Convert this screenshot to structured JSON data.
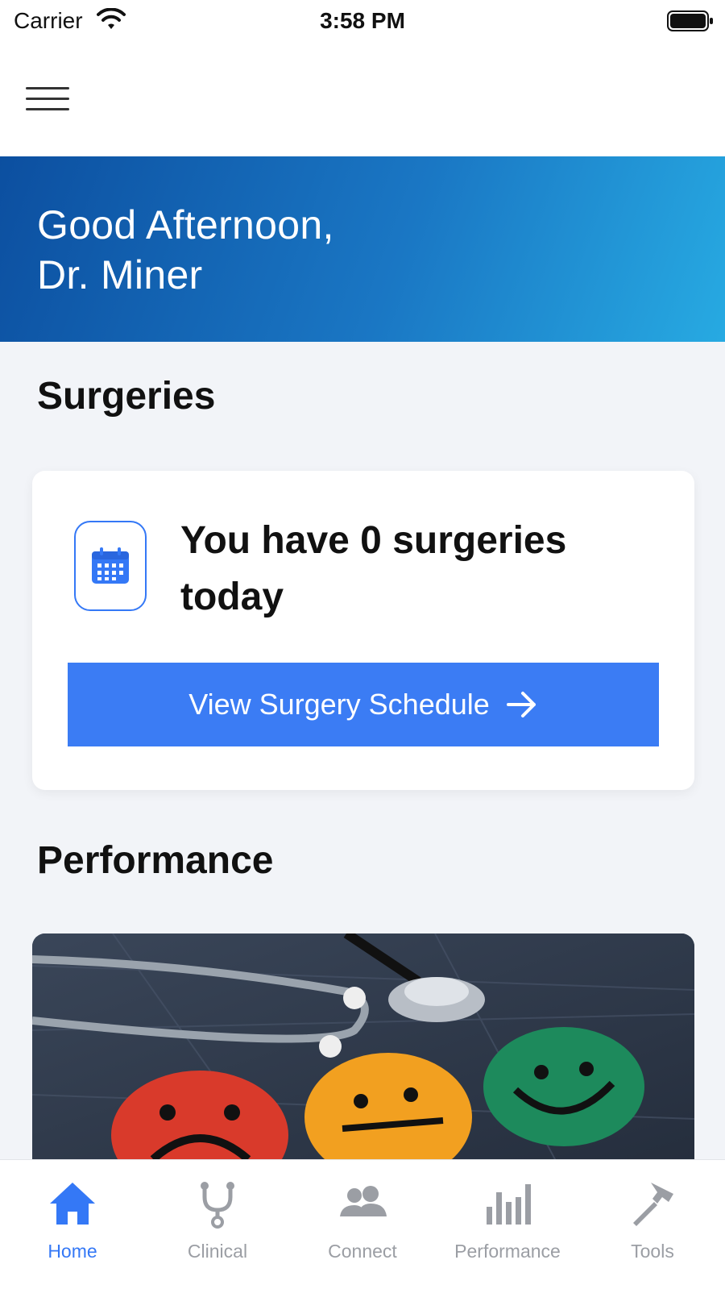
{
  "status_bar": {
    "carrier": "Carrier",
    "time": "3:58 PM"
  },
  "greeting": {
    "line1": "Good Afternoon,",
    "line2": "Dr. Miner"
  },
  "surgeries": {
    "section_title": "Surgeries",
    "count_text": "You have 0 surgeries today",
    "button_label": "View Surgery Schedule",
    "icon": "calendar-icon"
  },
  "performance": {
    "section_title": "Performance",
    "image": "stethoscope-with-sad-neutral-happy-faces"
  },
  "tabs": [
    {
      "label": "Home",
      "icon": "home-icon",
      "active": true
    },
    {
      "label": "Clinical",
      "icon": "stethoscope-icon",
      "active": false
    },
    {
      "label": "Connect",
      "icon": "people-icon",
      "active": false
    },
    {
      "label": "Performance",
      "icon": "bar-chart-icon",
      "active": false
    },
    {
      "label": "Tools",
      "icon": "hammer-icon",
      "active": false
    }
  ],
  "colors": {
    "accent": "#3478f6",
    "button": "#3b7cf4",
    "banner_start": "#0c4fa0",
    "banner_end": "#27aae2",
    "inactive_tab": "#9b9ea4",
    "background": "#f2f4f8"
  }
}
